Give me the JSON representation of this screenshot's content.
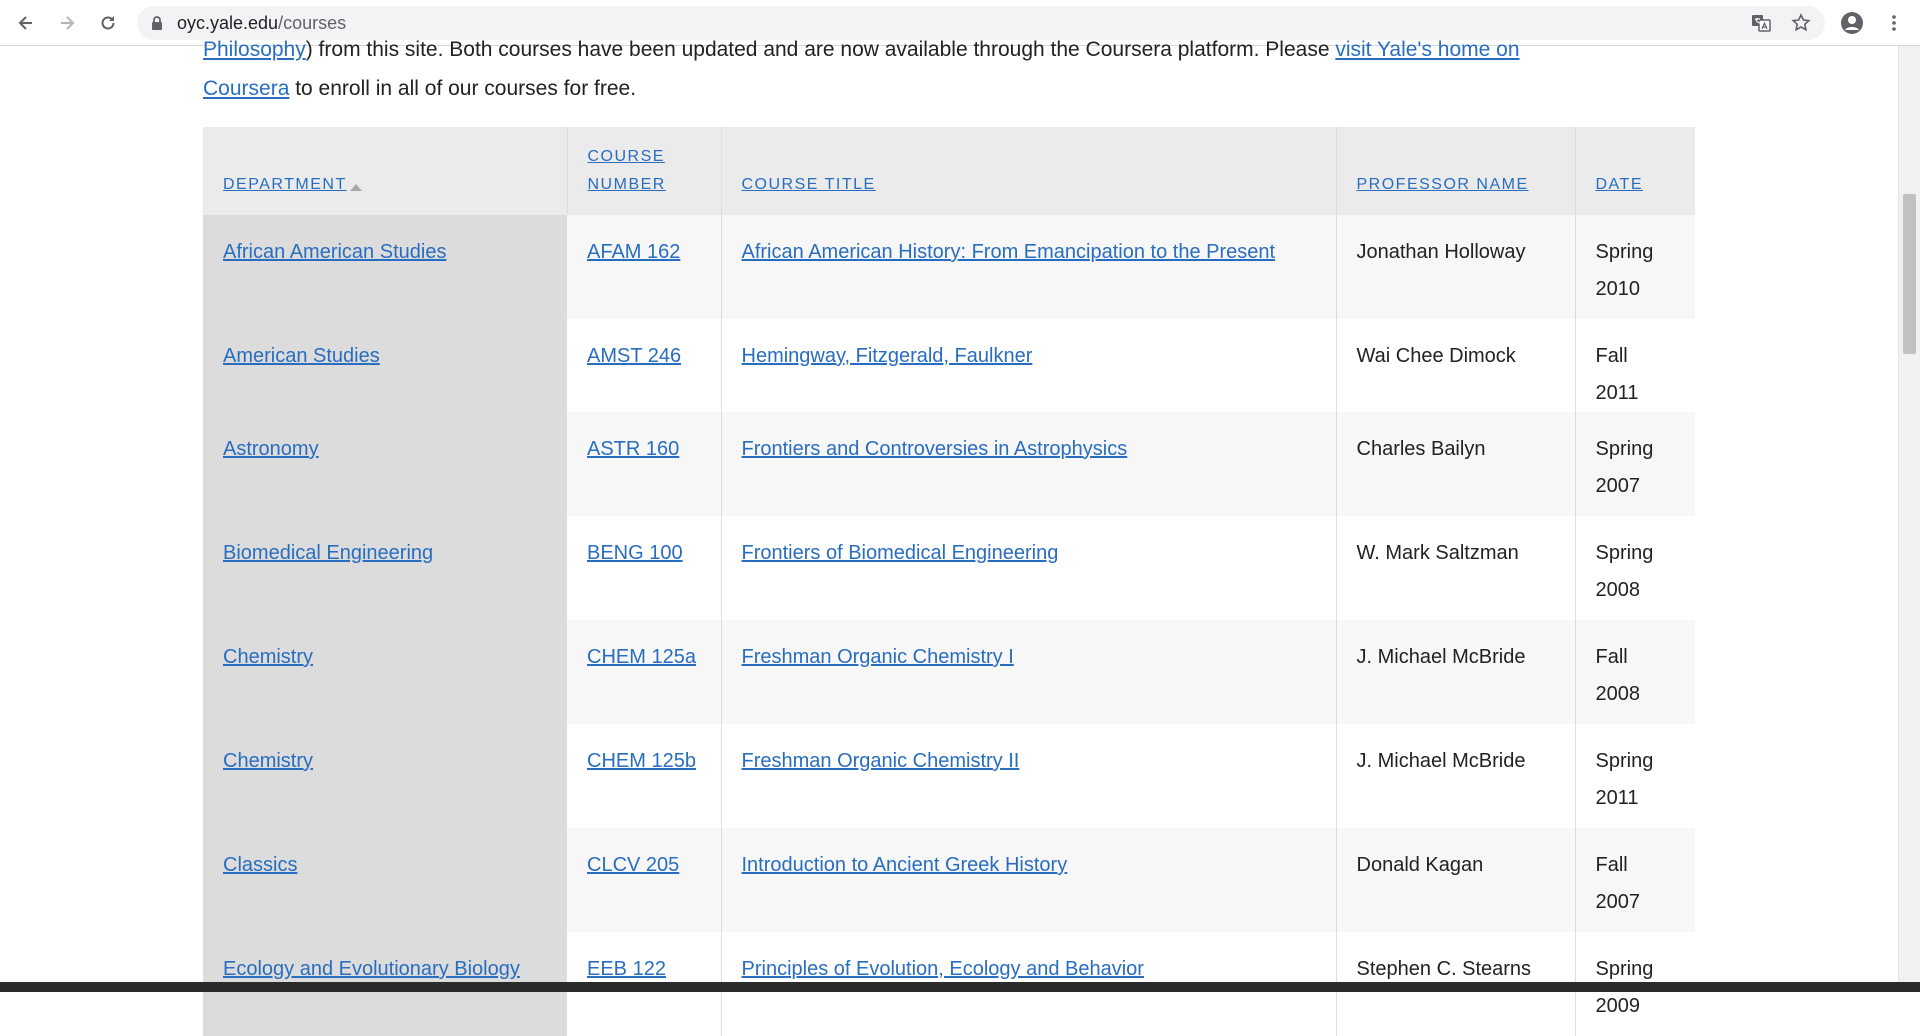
{
  "browser": {
    "url_host": "oyc.yale.edu",
    "url_path": "/courses"
  },
  "intro": {
    "line1_link1": "Philosophy",
    "line1_text": ") from this site. Both courses have been updated and are now available through the Coursera platform. Please ",
    "line1_link2": "visit Yale's home on",
    "line2_link": "Coursera",
    "line2_text": " to enroll in all of our courses for free."
  },
  "table": {
    "headers": {
      "department": "Department",
      "course_number": "Course Number",
      "course_title": "Course Title",
      "professor": "Professor Name",
      "date": "Date"
    },
    "rows": [
      {
        "department": "African American Studies",
        "number": "AFAM 162",
        "title": "African American History: From Emancipation to the Present",
        "professor": "Jonathan Holloway",
        "date": "Spring 2010"
      },
      {
        "department": "American Studies",
        "number": "AMST 246",
        "title": "Hemingway, Fitzgerald, Faulkner",
        "professor": "Wai Chee Dimock",
        "date": "Fall 2011"
      },
      {
        "department": "Astronomy",
        "number": "ASTR 160",
        "title": "Frontiers and Controversies in Astrophysics",
        "professor": "Charles Bailyn",
        "date": "Spring 2007"
      },
      {
        "department": "Biomedical Engineering",
        "number": "BENG 100",
        "title": "Frontiers of Biomedical Engineering",
        "professor": "W. Mark Saltzman",
        "date": "Spring 2008"
      },
      {
        "department": "Chemistry",
        "number": "CHEM 125a",
        "title": "Freshman Organic Chemistry I",
        "professor": "J. Michael McBride",
        "date": "Fall 2008"
      },
      {
        "department": "Chemistry",
        "number": "CHEM 125b",
        "title": "Freshman Organic Chemistry II",
        "professor": "J. Michael McBride",
        "date": "Spring 2011"
      },
      {
        "department": "Classics",
        "number": "CLCV 205",
        "title": "Introduction to Ancient Greek History",
        "professor": "Donald Kagan",
        "date": "Fall 2007"
      },
      {
        "department": "Ecology and Evolutionary Biology",
        "number": "EEB 122",
        "title": "Principles of Evolution, Ecology and Behavior",
        "professor": "Stephen C. Stearns",
        "date": "Spring 2009"
      }
    ]
  },
  "colors": {
    "link": "#286dc0",
    "header_bg": "#ebebeb",
    "dept_col_bg": "#dcdcdc",
    "row_alt_bg": "#f7f7f7"
  }
}
